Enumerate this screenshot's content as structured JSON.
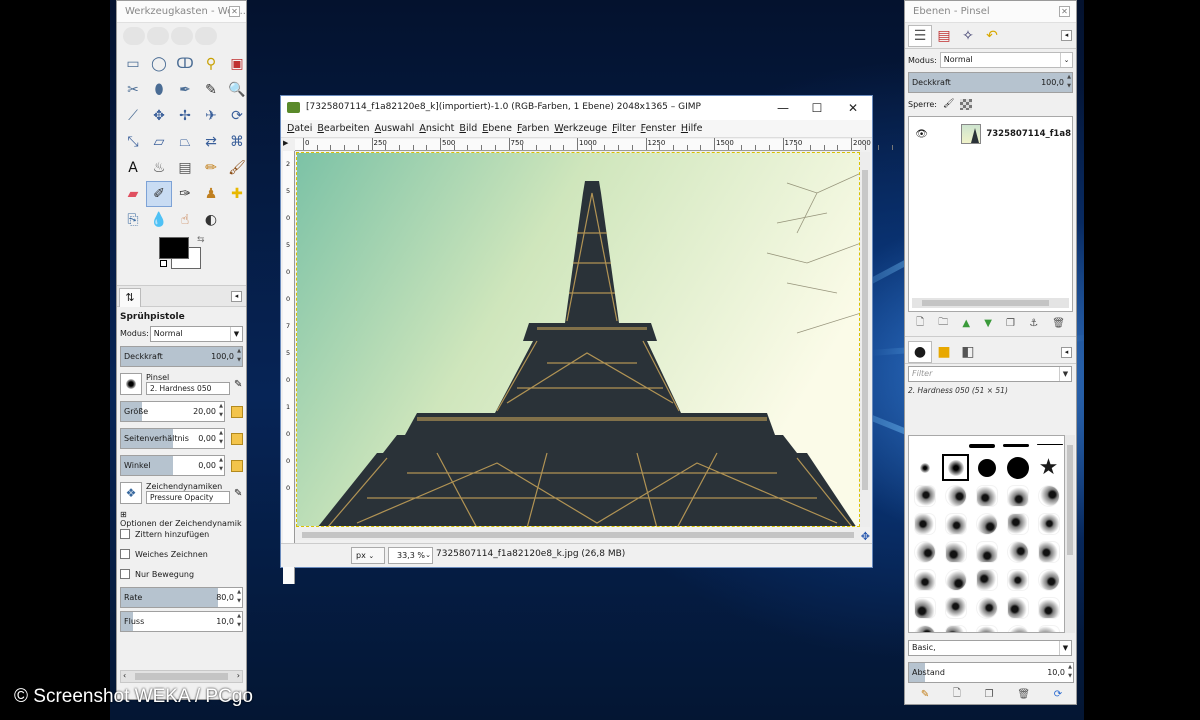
{
  "toolbox": {
    "title": "Werkzeugkasten - Wer...",
    "tools": [
      {
        "name": "rect-select-icon",
        "glyph": "▭",
        "color": "#4a6c94"
      },
      {
        "name": "ellipse-select-icon",
        "glyph": "◯",
        "color": "#4a6c94"
      },
      {
        "name": "free-select-icon",
        "glyph": "ↀ",
        "color": "#4a6c94"
      },
      {
        "name": "fuzzy-select-icon",
        "glyph": "⚲",
        "color": "#c8a000"
      },
      {
        "name": "color-select-icon",
        "glyph": "▣",
        "color": "#c03030"
      },
      {
        "name": "scissors-icon",
        "glyph": "✂",
        "color": "#4a6c94"
      },
      {
        "name": "foreground-select-icon",
        "glyph": "⬮",
        "color": "#4a6c94"
      },
      {
        "name": "paths-icon",
        "glyph": "✒",
        "color": "#4a6c94"
      },
      {
        "name": "color-picker-icon",
        "glyph": "✎",
        "color": "#333333"
      },
      {
        "name": "zoom-icon",
        "glyph": "🔍",
        "color": "#4a6c94"
      },
      {
        "name": "measure-icon",
        "glyph": "⟋",
        "color": "#4a6c94"
      },
      {
        "name": "move-icon",
        "glyph": "✥",
        "color": "#3a5f9a"
      },
      {
        "name": "align-icon",
        "glyph": "✢",
        "color": "#3a5f9a"
      },
      {
        "name": "crop-icon",
        "glyph": "✈",
        "color": "#3a5f9a"
      },
      {
        "name": "unified-transform-icon",
        "glyph": "⟳",
        "color": "#3a5f9a"
      },
      {
        "name": "scale-icon",
        "glyph": "⤡",
        "color": "#3a5f9a"
      },
      {
        "name": "shear-icon",
        "glyph": "▱",
        "color": "#3a5f9a"
      },
      {
        "name": "perspective-icon",
        "glyph": "⏢",
        "color": "#3a5f9a"
      },
      {
        "name": "flip-icon",
        "glyph": "⇄",
        "color": "#3a5f9a"
      },
      {
        "name": "cage-icon",
        "glyph": "⌘",
        "color": "#3a5f9a"
      },
      {
        "name": "text-icon",
        "glyph": "A",
        "color": "#111111"
      },
      {
        "name": "bucket-fill-icon",
        "glyph": "♨",
        "color": "#444444"
      },
      {
        "name": "gradient-icon",
        "glyph": "▤",
        "color": "#555555"
      },
      {
        "name": "pencil-icon",
        "glyph": "✏",
        "color": "#c07a10"
      },
      {
        "name": "paintbrush-icon",
        "glyph": "🖌",
        "color": "#8a4a10"
      },
      {
        "name": "eraser-icon",
        "glyph": "▰",
        "color": "#e05060"
      },
      {
        "name": "airbrush-icon",
        "glyph": "✐",
        "color": "#333333"
      },
      {
        "name": "ink-icon",
        "glyph": "✑",
        "color": "#333333"
      },
      {
        "name": "mypaint-brush-icon",
        "glyph": "♟",
        "color": "#c08020"
      },
      {
        "name": "heal-icon",
        "glyph": "✚",
        "color": "#e8b800"
      },
      {
        "name": "clone-icon",
        "glyph": "⎘",
        "color": "#3a6aa0"
      },
      {
        "name": "blur-icon",
        "glyph": "💧",
        "color": "#4a8ad0"
      },
      {
        "name": "smudge-icon",
        "glyph": "☝",
        "color": "#c06a30"
      },
      {
        "name": "dodge-burn-icon",
        "glyph": "◐",
        "color": "#333333"
      }
    ],
    "tab_icon": "⇅",
    "tool_options": {
      "title": "Sprühpistole",
      "mode_label": "Modus:",
      "mode_value": "Normal",
      "opacity": {
        "label": "Deckkraft",
        "value": "100,0",
        "fraction": 1.0
      },
      "brush_label": "Pinsel",
      "brush_value": "2. Hardness 050",
      "size": {
        "label": "Größe",
        "value": "20,00",
        "fraction": 0.2
      },
      "aspect": {
        "label": "Seitenverhältnis",
        "value": "0,00",
        "fraction": 0.5
      },
      "angle": {
        "label": "Winkel",
        "value": "0,00",
        "fraction": 0.5
      },
      "dynamics_label": "Zeichendynamiken",
      "dynamics_value": "Pressure Opacity",
      "dynamics_options": "Optionen der Zeichendynamik",
      "checks": [
        "Zittern hinzufügen",
        "Weiches Zeichnen",
        "Nur Bewegung"
      ],
      "rate": {
        "label": "Rate",
        "value": "80,0",
        "fraction": 0.8
      },
      "flow": {
        "label": "Fluss",
        "value": "10,0",
        "fraction": 0.1
      }
    }
  },
  "window": {
    "title": "[7325807114_f1a82120e8_k](importiert)-1.0 (RGB-Farben, 1 Ebene) 2048x1365 – GIMP",
    "menu": [
      "Datei",
      "Bearbeiten",
      "Auswahl",
      "Ansicht",
      "Bild",
      "Ebene",
      "Farben",
      "Werkzeuge",
      "Filter",
      "Fenster",
      "Hilfe"
    ],
    "ruler_h": [
      "0",
      "250",
      "500",
      "750",
      "1000",
      "1250",
      "1500",
      "1750",
      "2000"
    ],
    "ruler_v": [
      "2",
      "5",
      "0",
      "5",
      "0",
      "0",
      "7",
      "5",
      "0",
      "1",
      "0",
      "0",
      "0"
    ],
    "unit": "px",
    "zoom": "33,3 %",
    "status": "7325807114_f1a82120e8_k.jpg (26,8 MB)"
  },
  "layers": {
    "title": "Ebenen - Pinsel",
    "mode_label": "Modus:",
    "mode_value": "Normal",
    "opacity": {
      "label": "Deckkraft",
      "value": "100,0",
      "fraction": 1.0
    },
    "lock_label": "Sperre:",
    "layer_name": "7325807114_f1a8"
  },
  "brushes": {
    "filter_placeholder": "Filter",
    "selected": "2. Hardness 050 (51 × 51)",
    "tag": "Basic,",
    "spacing": {
      "label": "Abstand",
      "value": "10,0",
      "fraction": 0.1
    }
  },
  "watermark": "© Screenshot WEKA / PCgo"
}
